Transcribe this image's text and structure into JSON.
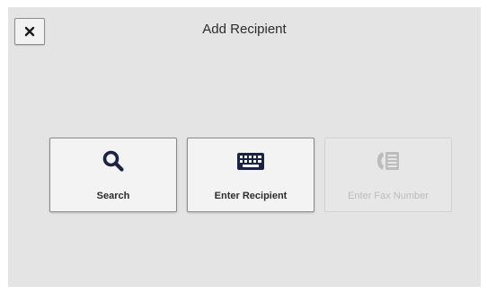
{
  "header": {
    "title": "Add Recipient",
    "close_icon": "close-icon"
  },
  "options": [
    {
      "label": "Search",
      "icon": "search-icon",
      "enabled": true
    },
    {
      "label": "Enter Recipient",
      "icon": "keyboard-icon",
      "enabled": true
    },
    {
      "label": "Enter Fax Number",
      "icon": "fax-number-icon",
      "enabled": false
    }
  ],
  "colors": {
    "icon_navy": "#1c2340",
    "disabled_gray": "#bcbcbc",
    "panel_background": "#e4e4e4"
  }
}
